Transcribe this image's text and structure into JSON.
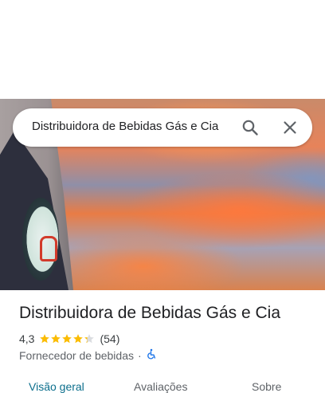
{
  "search": {
    "query": "Distribuidora de Bebidas Gás e Cia",
    "search_icon": "search-icon",
    "close_icon": "close-icon"
  },
  "place": {
    "name": "Distribuidora de Bebidas Gás e Cia",
    "rating": "4,3",
    "stars": 4.3,
    "review_count": "(54)",
    "category": "Fornecedor de bebidas",
    "separator": "·",
    "accessibility_icon": "wheelchair-icon"
  },
  "tabs": [
    {
      "label": "Visão geral",
      "active": true
    },
    {
      "label": "Avaliações",
      "active": false
    },
    {
      "label": "Sobre",
      "active": false
    }
  ],
  "colors": {
    "star": "#fbbc04",
    "star_empty": "#dadce0",
    "active_tab": "#0b6e8c",
    "accessibility": "#1a73e8"
  }
}
